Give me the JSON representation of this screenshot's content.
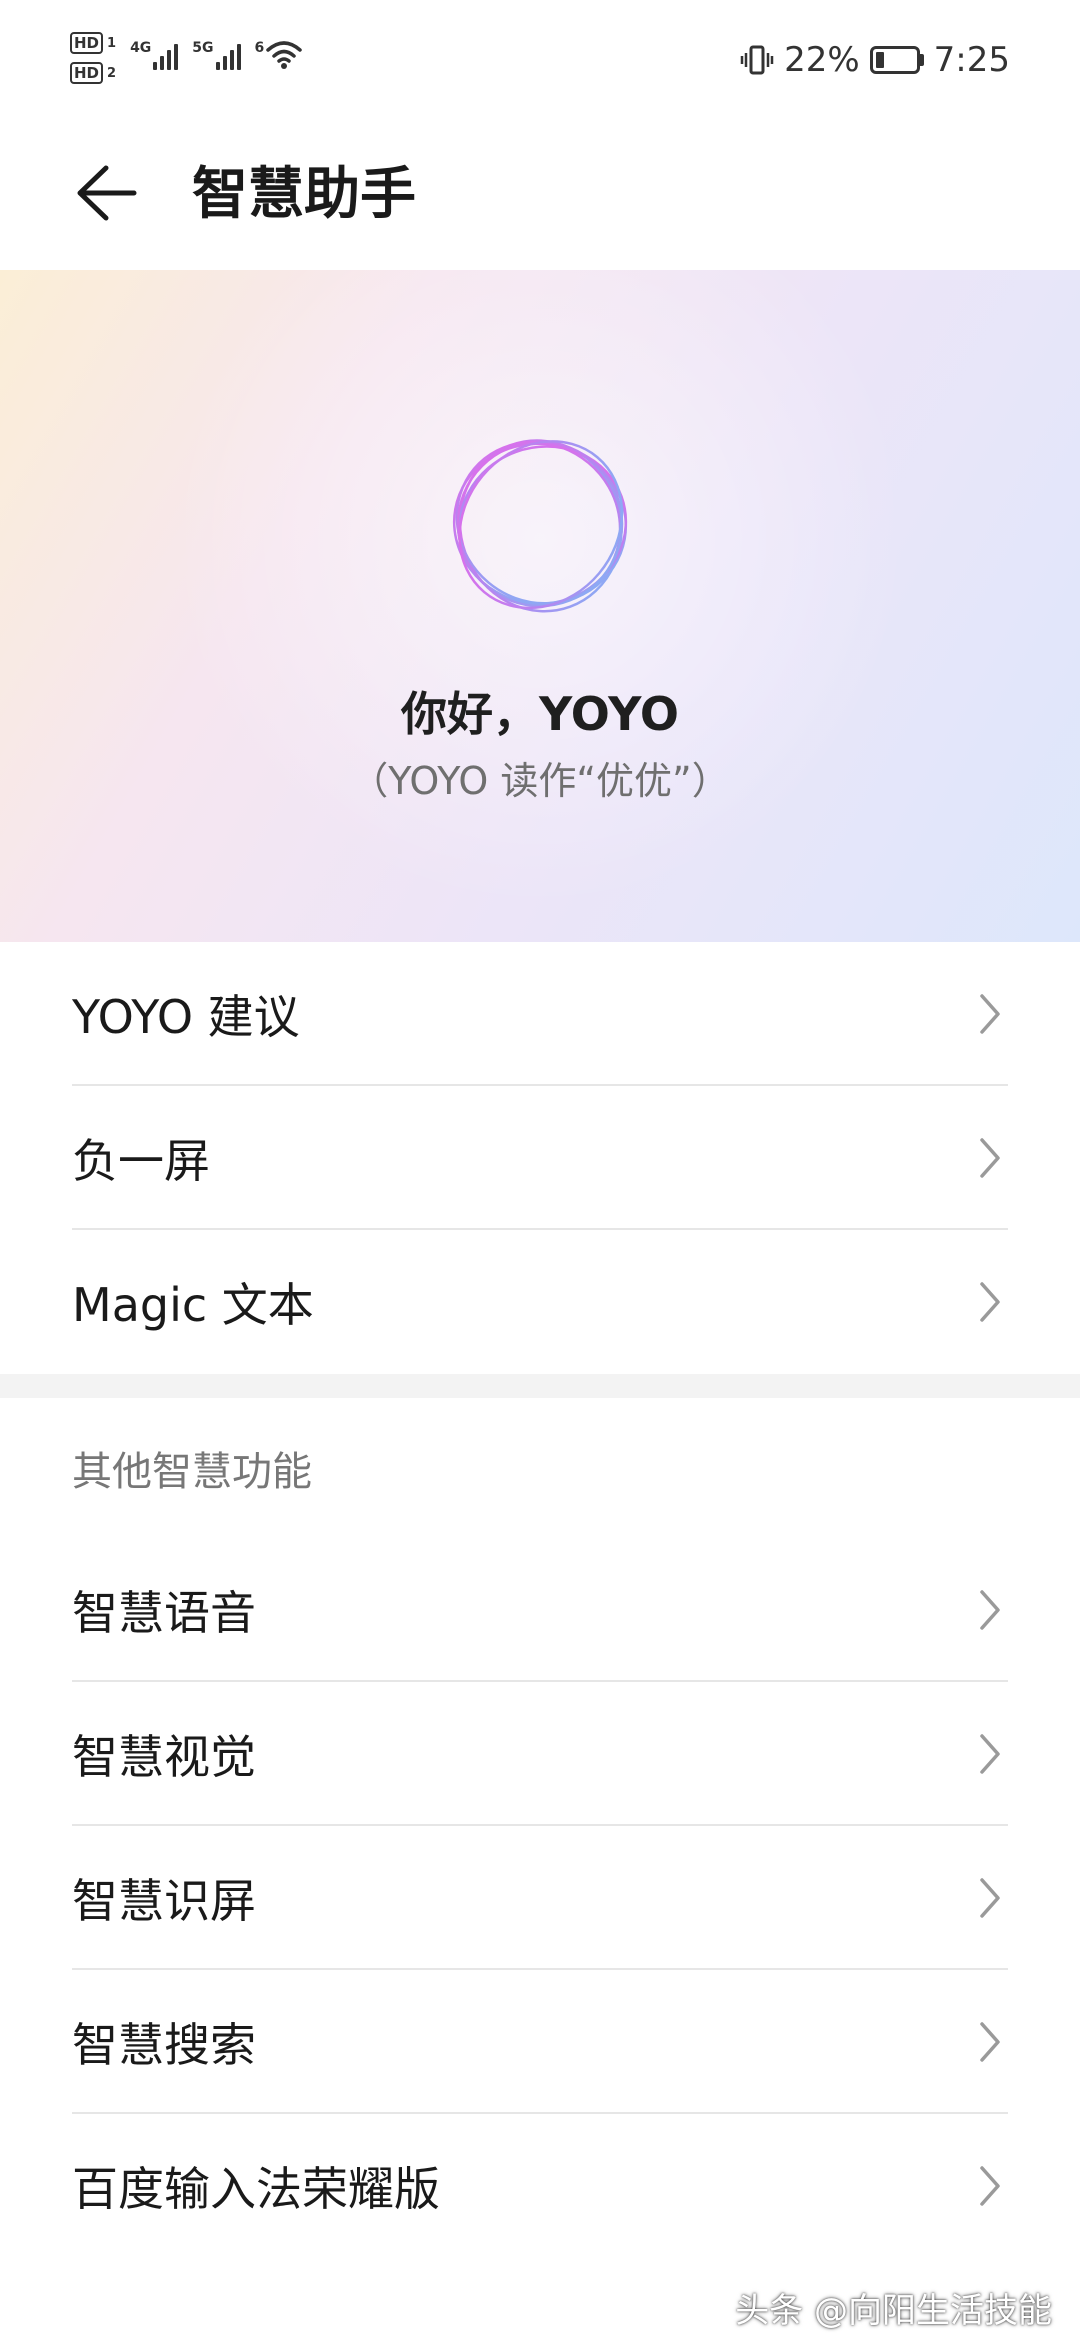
{
  "status_bar": {
    "sim1_badge": "HD",
    "sim1_num": "1",
    "sim2_badge": "HD",
    "sim2_num": "2",
    "net1": "4G",
    "net2": "5G",
    "wifi_tag": "6",
    "battery_percent": "22%",
    "battery_level": 0.22,
    "time": "7:25",
    "icons": [
      "signal-bars-icon",
      "wifi-icon",
      "vibrate-icon",
      "battery-icon"
    ]
  },
  "header": {
    "title": "智慧助手",
    "back_icon": "arrow-left-icon"
  },
  "hero": {
    "greeting": "你好，YOYO",
    "subtitle": "（YOYO 读作“优优”）",
    "orb_colors": [
      "#e35be8",
      "#b07af0",
      "#6fb2f5"
    ]
  },
  "main_list": [
    {
      "label": "YOYO 建议"
    },
    {
      "label": "负一屏"
    },
    {
      "label": "Magic 文本"
    }
  ],
  "other_section": {
    "header": "其他智慧功能",
    "items": [
      {
        "label": "智慧语音"
      },
      {
        "label": "智慧视觉"
      },
      {
        "label": "智慧识屏"
      },
      {
        "label": "智慧搜索"
      },
      {
        "label": "百度输入法荣耀版"
      }
    ]
  },
  "watermark": "头条 @向阳生活技能",
  "colors": {
    "chevron": "#9a9a9a",
    "divider": "#e6e6e6",
    "section_header": "#777777"
  }
}
